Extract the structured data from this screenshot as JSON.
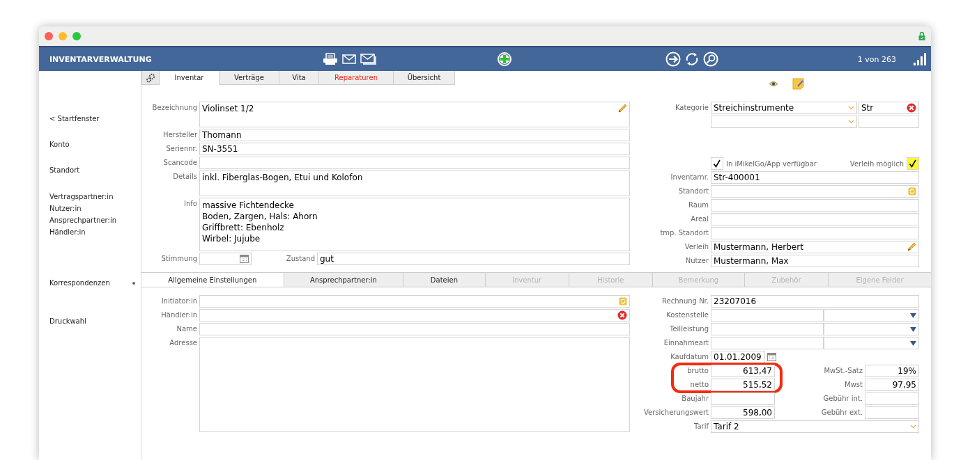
{
  "header": {
    "title": "INVENTARVERWALTUNG",
    "counter": "1 von 263"
  },
  "sidebar": {
    "groups": [
      [
        {
          "label": "< Startfenster",
          "indicator": false
        }
      ],
      [
        {
          "label": "Konto",
          "indicator": false
        }
      ],
      [
        {
          "label": "Standort",
          "indicator": false
        }
      ],
      [
        {
          "label": "Vertragspartner:in",
          "indicator": false
        },
        {
          "label": "Nutzer:in",
          "indicator": false
        },
        {
          "label": "Ansprechpartner:in",
          "indicator": false
        },
        {
          "label": "Händler:in",
          "indicator": false
        }
      ],
      [
        {
          "label": "Korrespondenzen",
          "indicator": true
        }
      ],
      [
        {
          "label": "Druckwahl",
          "indicator": false
        }
      ]
    ]
  },
  "tabs": [
    {
      "label": "Inventar",
      "selected": true,
      "alert": false
    },
    {
      "label": "Verträge",
      "selected": false,
      "alert": false
    },
    {
      "label": "Vita",
      "selected": false,
      "alert": false
    },
    {
      "label": "Reparaturen",
      "selected": false,
      "alert": true
    },
    {
      "label": "Übersicht",
      "selected": false,
      "alert": false
    }
  ],
  "upper_left": [
    {
      "kind": "memo",
      "label": "Bezeichnung",
      "value": "Violinset 1/2",
      "editable": true
    },
    {
      "kind": "text",
      "label": "Hersteller",
      "value": "Thomann"
    },
    {
      "kind": "text",
      "label": "Seriennr.",
      "value": "SN-3551"
    },
    {
      "kind": "text",
      "label": "Scancode"
    },
    {
      "kind": "memo",
      "label": "Details",
      "value": "inkl. Fiberglas-Bogen, Etui und Kolofon"
    },
    {
      "kind": "notes",
      "label": "Info",
      "value": "massive Fichtendecke\nBoden, Zargen, Hals: Ahorn\nGriffbrett: Ebenholz\nWirbel: Jujube"
    },
    {
      "kind": "date-pair",
      "label": "Stimmung",
      "second": {
        "label": "Zustand",
        "value": "gut"
      }
    }
  ],
  "upper_right": [
    {
      "kind": "category",
      "label": "Kategorie",
      "value": "Streichinstrumente",
      "code": "Str"
    },
    {
      "kind": "category"
    },
    {
      "kind": "checks",
      "items": [
        {
          "label": "In iMikelGo/App verfügbar",
          "checked": true,
          "color": "#ffffff"
        },
        {
          "label": "Verleih möglich",
          "checked": true,
          "color": "#fcf932"
        }
      ]
    },
    {
      "kind": "text",
      "label": "Inventarnr.",
      "value": "Str-400001"
    },
    {
      "kind": "lookup",
      "label": "Standort"
    },
    {
      "kind": "text",
      "label": "Raum"
    },
    {
      "kind": "text",
      "label": "Areal"
    },
    {
      "kind": "text",
      "label": "tmp. Standort"
    },
    {
      "kind": "text",
      "label": "Verleih",
      "value": "Mustermann, Herbert",
      "editable": true
    },
    {
      "kind": "text",
      "label": "Nutzer",
      "value": "Mustermann, Max"
    }
  ],
  "lower_tabs": [
    {
      "label": "Allgemeine Einstellungen",
      "selected": true,
      "disabled": false
    },
    {
      "label": "Ansprechpartner:in",
      "selected": false,
      "disabled": false
    },
    {
      "label": "Dateien",
      "selected": false,
      "disabled": false
    },
    {
      "label": "Inventur",
      "selected": false,
      "disabled": true
    },
    {
      "label": "Historie",
      "selected": false,
      "disabled": true
    },
    {
      "label": "Bemerkung",
      "selected": false,
      "disabled": true
    },
    {
      "label": "Zubehör",
      "selected": false,
      "disabled": true
    },
    {
      "label": "Eigene Felder",
      "selected": false,
      "disabled": true
    }
  ],
  "lower_left": [
    {
      "kind": "lookup",
      "label": "Initiator:in"
    },
    {
      "kind": "removable",
      "label": "Händler:in"
    },
    {
      "kind": "text",
      "label": "Name"
    },
    {
      "kind": "address",
      "label": "Adresse"
    }
  ],
  "lower_right": [
    {
      "kind": "text",
      "label": "Rechnung Nr.",
      "value": "23207016"
    },
    {
      "kind": "dual-select",
      "label": "Kostenstelle"
    },
    {
      "kind": "dual-select",
      "label": "Teilleistung"
    },
    {
      "kind": "dual-select",
      "label": "Einnahmeart"
    },
    {
      "kind": "date",
      "label": "Kaufdatum",
      "value": "01.01.2009"
    },
    {
      "kind": "circled-group",
      "rows": [
        {
          "kind": "amount-pair",
          "label": "brutto",
          "value": "613,47",
          "second": {
            "label": "MwSt.-Satz",
            "value": "19%"
          }
        },
        {
          "kind": "amount-pair",
          "label": "netto",
          "value": "515,52",
          "second": {
            "label": "Mwst",
            "value": "97,95"
          }
        }
      ]
    },
    {
      "kind": "amount-pair",
      "label": "Baujahr",
      "second": {
        "label": "Gebühr int."
      }
    },
    {
      "kind": "amount-pair",
      "label": "Versicherungswert",
      "value": "598,00",
      "second": {
        "label": "Gebühr ext."
      }
    },
    {
      "kind": "select",
      "label": "Tarif",
      "value": "Tarif 2"
    }
  ]
}
